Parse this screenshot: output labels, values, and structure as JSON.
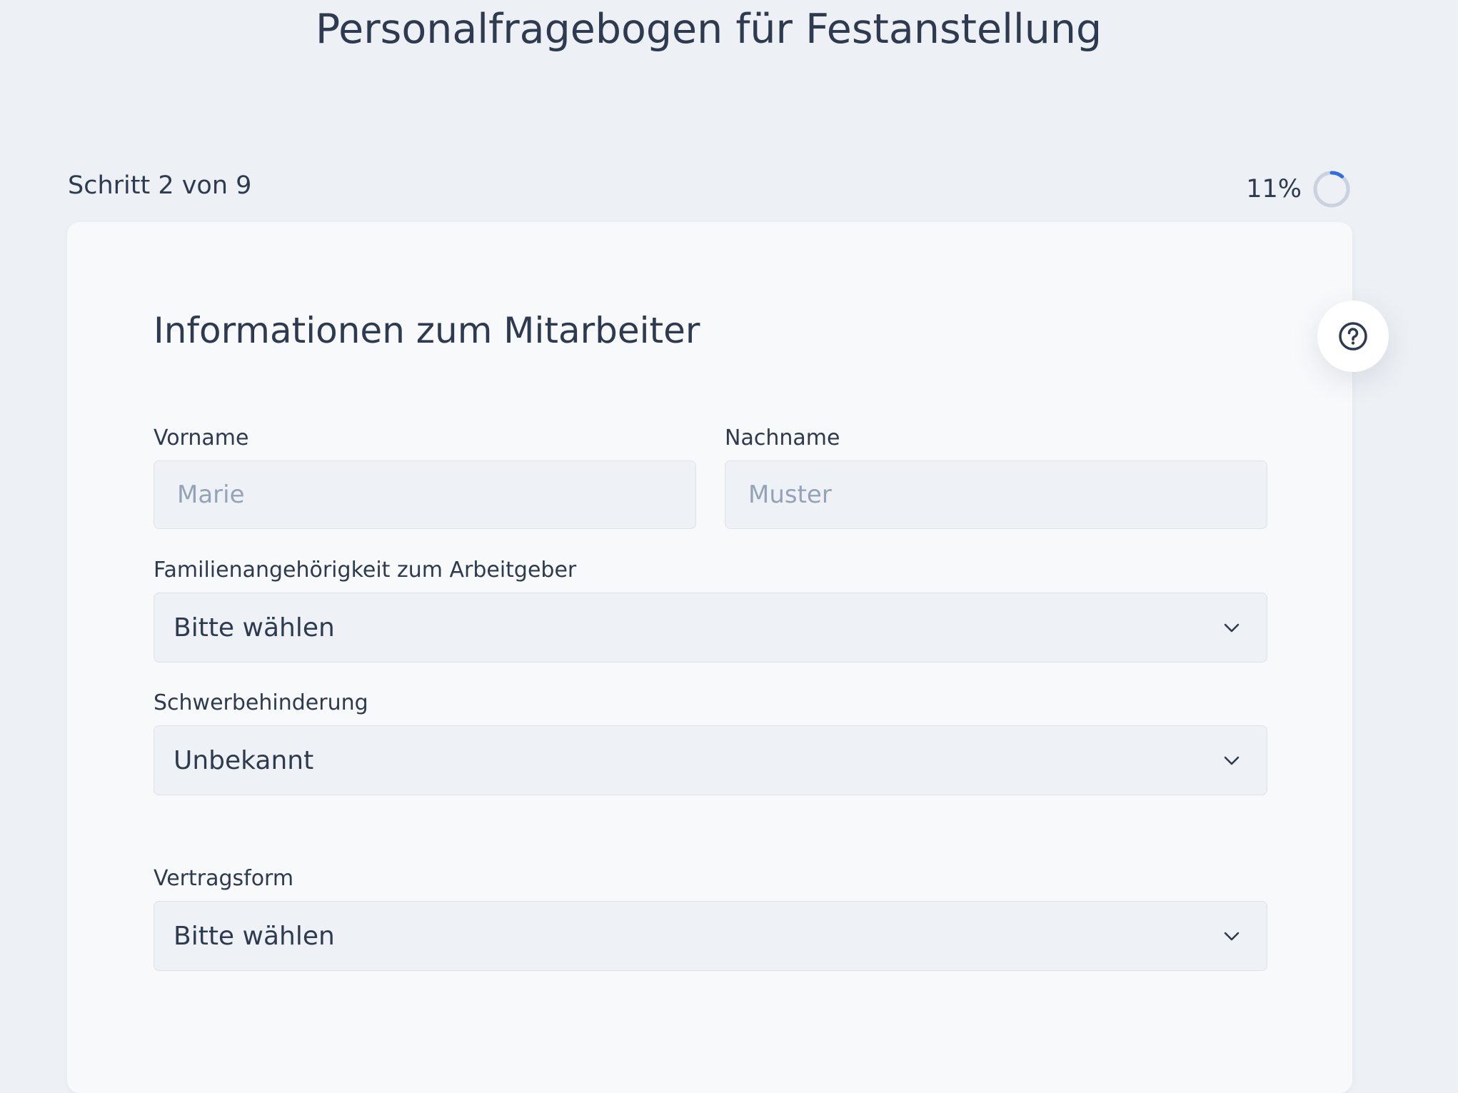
{
  "header": {
    "title": "Personalfragebogen für Festanstellung"
  },
  "progress": {
    "step_label": "Schritt 2 von 9",
    "percent_text": "11%",
    "percent": 11
  },
  "section": {
    "title": "Informationen zum Mitarbeiter"
  },
  "fields": {
    "vorname": {
      "label": "Vorname",
      "placeholder": "Marie",
      "value": ""
    },
    "nachname": {
      "label": "Nachname",
      "placeholder": "Muster",
      "value": ""
    },
    "familie": {
      "label": "Familienangehörigkeit zum Arbeitgeber",
      "selected": "Bitte wählen"
    },
    "schwerbehinderung": {
      "label": "Schwerbehinderung",
      "selected": "Unbekannt"
    },
    "vertragsform": {
      "label": "Vertragsform",
      "selected": "Bitte wählen"
    }
  },
  "icons": {
    "help": "question-circle-icon",
    "chevron": "chevron-down-icon",
    "progress": "progress-ring-icon"
  },
  "colors": {
    "text": "#2d3a4f",
    "accent": "#2f6fe0",
    "field_bg": "#eef2f6",
    "placeholder": "#94a3b8"
  }
}
